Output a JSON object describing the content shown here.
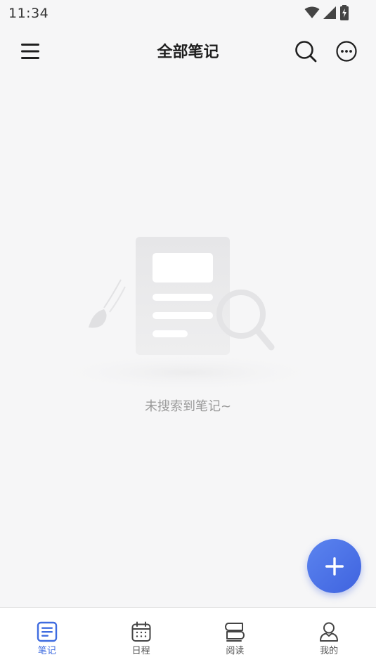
{
  "status_bar": {
    "time": "11:34",
    "icons": [
      "wifi-icon",
      "signal-icon",
      "battery-charging-icon"
    ]
  },
  "header": {
    "title": "全部笔记",
    "left_icon": "menu-icon",
    "right_icons": [
      "search-icon",
      "more-icon"
    ]
  },
  "empty_state": {
    "message": "未搜索到笔记~",
    "illustration_icon": "empty-notes-search-icon"
  },
  "fab": {
    "icon": "plus-icon"
  },
  "bottom_nav": {
    "items": [
      {
        "label": "笔记",
        "icon": "notes-icon",
        "active": true
      },
      {
        "label": "日程",
        "icon": "calendar-icon",
        "active": false
      },
      {
        "label": "阅读",
        "icon": "reading-icon",
        "active": false
      },
      {
        "label": "我的",
        "icon": "profile-icon",
        "active": false
      }
    ]
  },
  "colors": {
    "accent": "#3f6ce0",
    "background": "#f6f6f7",
    "fab_gradient_start": "#5b84ef",
    "fab_gradient_end": "#3f63df",
    "inactive_icon": "#444444",
    "empty_text": "#9a9a9a"
  }
}
